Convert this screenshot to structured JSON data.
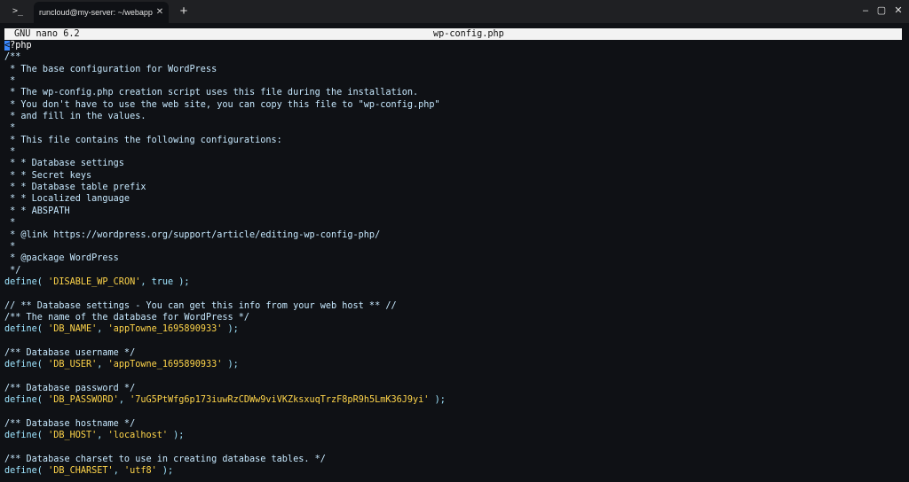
{
  "window": {
    "tab_title": "runcloud@my-server: ~/webapps/a",
    "terminal_icon": "terminal-icon",
    "close_tab_icon": "close-icon",
    "new_tab_icon": "plus-icon",
    "minimize_icon": "minimize-icon",
    "maximize_icon": "maximize-icon",
    "close_window_icon": "close-window-icon"
  },
  "nano": {
    "version": "GNU nano 6.2",
    "filename": "wp-config.php"
  },
  "code": [
    [
      {
        "t": "<",
        "c": "cursor"
      },
      {
        "t": "?php",
        "c": "ph"
      }
    ],
    [
      {
        "t": "/**",
        "c": "cm"
      }
    ],
    [
      {
        "t": " * The base configuration for WordPress",
        "c": "cm"
      }
    ],
    [
      {
        "t": " *",
        "c": "cm"
      }
    ],
    [
      {
        "t": " * The wp-config.php creation script uses this file during the installation.",
        "c": "cm"
      }
    ],
    [
      {
        "t": " * You don't have to use the web site, you can copy this file to \"wp-config.php\"",
        "c": "cm"
      }
    ],
    [
      {
        "t": " * and fill in the values.",
        "c": "cm"
      }
    ],
    [
      {
        "t": " *",
        "c": "cm"
      }
    ],
    [
      {
        "t": " * This file contains the following configurations:",
        "c": "cm"
      }
    ],
    [
      {
        "t": " *",
        "c": "cm"
      }
    ],
    [
      {
        "t": " * * Database settings",
        "c": "cm"
      }
    ],
    [
      {
        "t": " * * Secret keys",
        "c": "cm"
      }
    ],
    [
      {
        "t": " * * Database table prefix",
        "c": "cm"
      }
    ],
    [
      {
        "t": " * * Localized language",
        "c": "cm"
      }
    ],
    [
      {
        "t": " * * ABSPATH",
        "c": "cm"
      }
    ],
    [
      {
        "t": " *",
        "c": "cm"
      }
    ],
    [
      {
        "t": " * @link https://wordpress.org/support/article/editing-wp-config-php/",
        "c": "cm"
      }
    ],
    [
      {
        "t": " *",
        "c": "cm"
      }
    ],
    [
      {
        "t": " * @package WordPress",
        "c": "cm"
      }
    ],
    [
      {
        "t": " */",
        "c": "cm"
      }
    ],
    [
      {
        "t": "define( ",
        "c": "kw"
      },
      {
        "t": "'DISABLE_WP_CRON'",
        "c": "st"
      },
      {
        "t": ", true );",
        "c": "kw"
      }
    ],
    [
      {
        "t": "",
        "c": "kw"
      }
    ],
    [
      {
        "t": "// ** Database settings - You can get this info from your web host ** //",
        "c": "cm"
      }
    ],
    [
      {
        "t": "/** The name of the database for WordPress */",
        "c": "cm"
      }
    ],
    [
      {
        "t": "define( ",
        "c": "kw"
      },
      {
        "t": "'DB_NAME'",
        "c": "st"
      },
      {
        "t": ", ",
        "c": "kw"
      },
      {
        "t": "'appTowne_1695890933'",
        "c": "st"
      },
      {
        "t": " );",
        "c": "kw"
      }
    ],
    [
      {
        "t": "",
        "c": "kw"
      }
    ],
    [
      {
        "t": "/** Database username */",
        "c": "cm"
      }
    ],
    [
      {
        "t": "define( ",
        "c": "kw"
      },
      {
        "t": "'DB_USER'",
        "c": "st"
      },
      {
        "t": ", ",
        "c": "kw"
      },
      {
        "t": "'appTowne_1695890933'",
        "c": "st"
      },
      {
        "t": " );",
        "c": "kw"
      }
    ],
    [
      {
        "t": "",
        "c": "kw"
      }
    ],
    [
      {
        "t": "/** Database password */",
        "c": "cm"
      }
    ],
    [
      {
        "t": "define( ",
        "c": "kw"
      },
      {
        "t": "'DB_PASSWORD'",
        "c": "st"
      },
      {
        "t": ", ",
        "c": "kw"
      },
      {
        "t": "'7uG5PtWfg6p173iuwRzCDWw9viVKZksxuqTrzF8pR9h5LmK36J9yi'",
        "c": "st"
      },
      {
        "t": " );",
        "c": "kw"
      }
    ],
    [
      {
        "t": "",
        "c": "kw"
      }
    ],
    [
      {
        "t": "/** Database hostname */",
        "c": "cm"
      }
    ],
    [
      {
        "t": "define( ",
        "c": "kw"
      },
      {
        "t": "'DB_HOST'",
        "c": "st"
      },
      {
        "t": ", ",
        "c": "kw"
      },
      {
        "t": "'localhost'",
        "c": "st"
      },
      {
        "t": " );",
        "c": "kw"
      }
    ],
    [
      {
        "t": "",
        "c": "kw"
      }
    ],
    [
      {
        "t": "/** Database charset to use in creating database tables. */",
        "c": "cm"
      }
    ],
    [
      {
        "t": "define( ",
        "c": "kw"
      },
      {
        "t": "'DB_CHARSET'",
        "c": "st"
      },
      {
        "t": ", ",
        "c": "kw"
      },
      {
        "t": "'utf8'",
        "c": "st"
      },
      {
        "t": " );",
        "c": "kw"
      }
    ]
  ]
}
